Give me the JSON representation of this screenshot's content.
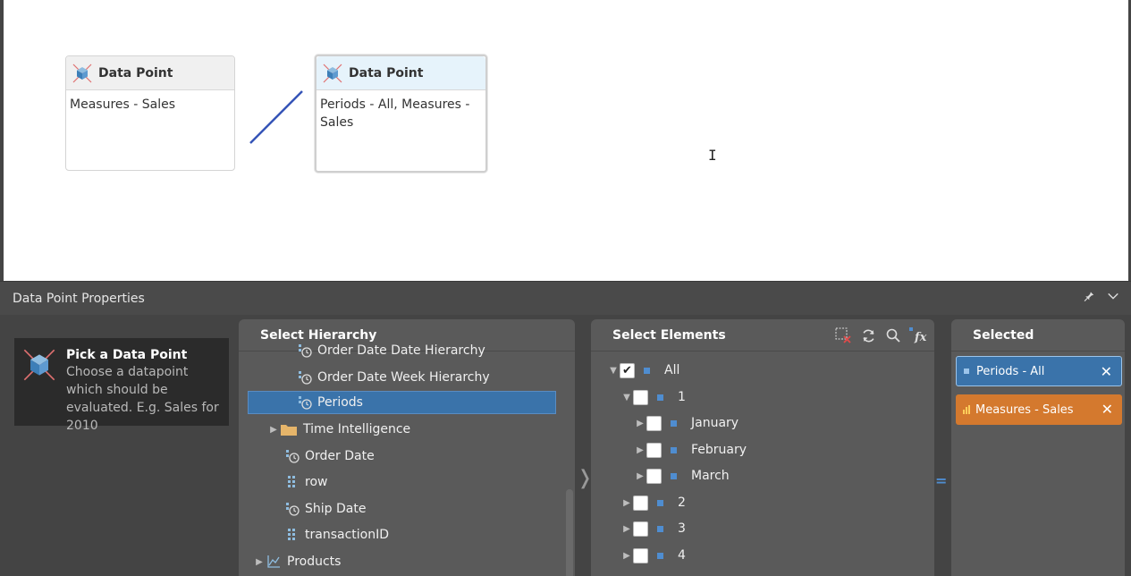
{
  "canvas": {
    "card1": {
      "title": "Data Point",
      "body": "Measures - Sales"
    },
    "card2": {
      "title": "Data Point",
      "body": "Periods - All, Measures - Sales"
    }
  },
  "panel": {
    "title": "Data Point Properties",
    "pin_icon": "pin-icon",
    "collapse_icon": "chevron-down-icon"
  },
  "hint": {
    "title": "Pick a Data Point",
    "text": "Choose a datapoint which should be evaluated. E.g. Sales for 2010"
  },
  "hierarchy": {
    "title": "Select Hierarchy",
    "items": [
      {
        "label": "Order Date Date Hierarchy",
        "icon": "hierarchy-clock-icon"
      },
      {
        "label": "Order Date Week Hierarchy",
        "icon": "hierarchy-clock-icon"
      },
      {
        "label": "Periods",
        "icon": "hierarchy-clock-icon",
        "selected": true
      },
      {
        "label": "Time Intelligence",
        "icon": "folder-icon"
      },
      {
        "label": "Order Date",
        "icon": "hierarchy-clock-icon"
      },
      {
        "label": "row",
        "icon": "attribute-icon"
      },
      {
        "label": "Ship Date",
        "icon": "hierarchy-clock-icon"
      },
      {
        "label": "transactionID",
        "icon": "attribute-icon"
      },
      {
        "label": "Products",
        "icon": "dimension-icon"
      }
    ]
  },
  "elements": {
    "title": "Select Elements",
    "items": [
      {
        "label": "All",
        "checked": true
      },
      {
        "label": "1",
        "checked": false
      },
      {
        "label": "January",
        "checked": false
      },
      {
        "label": "February",
        "checked": false
      },
      {
        "label": "March",
        "checked": false
      },
      {
        "label": "2",
        "checked": false
      },
      {
        "label": "3",
        "checked": false
      },
      {
        "label": "4",
        "checked": false
      }
    ]
  },
  "selected": {
    "title": "Selected",
    "chips": [
      {
        "label": "Periods - All",
        "color": "#3a73aa"
      },
      {
        "label": "Measures - Sales",
        "color": "#d4792e"
      }
    ]
  },
  "equals_sign": "="
}
